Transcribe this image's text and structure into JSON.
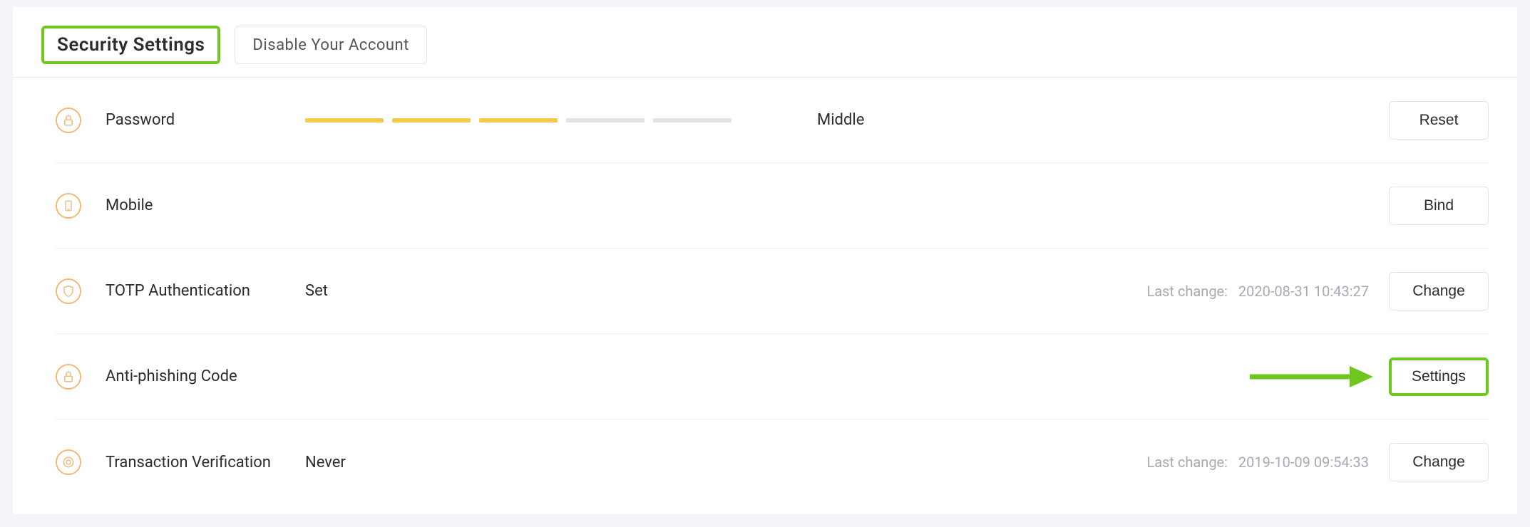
{
  "tabs": {
    "security": "Security Settings",
    "disable": "Disable Your Account"
  },
  "rows": {
    "password": {
      "label": "Password",
      "strength_text": "Middle",
      "strength_filled": 3,
      "strength_total": 5,
      "action": "Reset"
    },
    "mobile": {
      "label": "Mobile",
      "action": "Bind"
    },
    "totp": {
      "label": "TOTP Authentication",
      "value": "Set",
      "meta_label": "Last change:",
      "meta_value": "2020-08-31 10:43:27",
      "action": "Change"
    },
    "antiphish": {
      "label": "Anti-phishing Code",
      "action": "Settings"
    },
    "txverify": {
      "label": "Transaction Verification",
      "value": "Never",
      "meta_label": "Last change:",
      "meta_value": "2019-10-09 09:54:33",
      "action": "Change"
    }
  },
  "colors": {
    "highlight": "#6ec71e",
    "icon": "#f4b97a",
    "bar_filled": "#f7c948",
    "bar_empty": "#e2e2e8"
  }
}
